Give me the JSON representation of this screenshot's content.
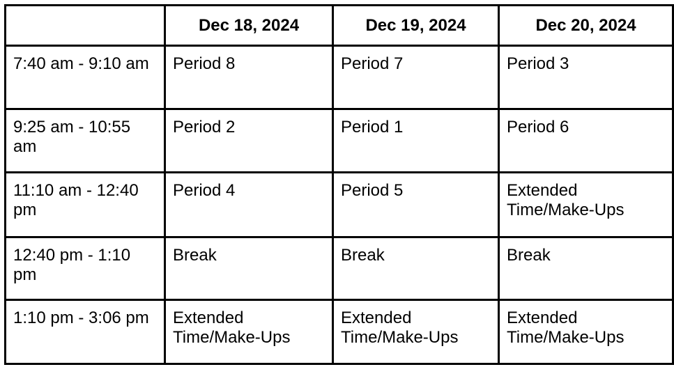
{
  "schedule": {
    "headers": [
      "",
      "Dec 18, 2024",
      "Dec 19, 2024",
      "Dec 20, 2024"
    ],
    "rows": [
      {
        "time": "7:40 am - 9:10 am",
        "cells": [
          "Period 8",
          "Period 7",
          "Period 3"
        ]
      },
      {
        "time": "9:25 am - 10:55 am",
        "cells": [
          "Period 2",
          "Period 1",
          "Period 6"
        ]
      },
      {
        "time": "11:10 am - 12:40 pm",
        "cells": [
          "Period 4",
          "Period 5",
          "Extended Time/Make-Ups"
        ]
      },
      {
        "time": "12:40 pm - 1:10 pm",
        "cells": [
          "Break",
          "Break",
          "Break"
        ]
      },
      {
        "time": "1:10 pm - 3:06 pm",
        "cells": [
          "Extended Time/Make-Ups",
          "Extended Time/Make-Ups",
          "Extended Time/Make-Ups"
        ]
      }
    ]
  }
}
